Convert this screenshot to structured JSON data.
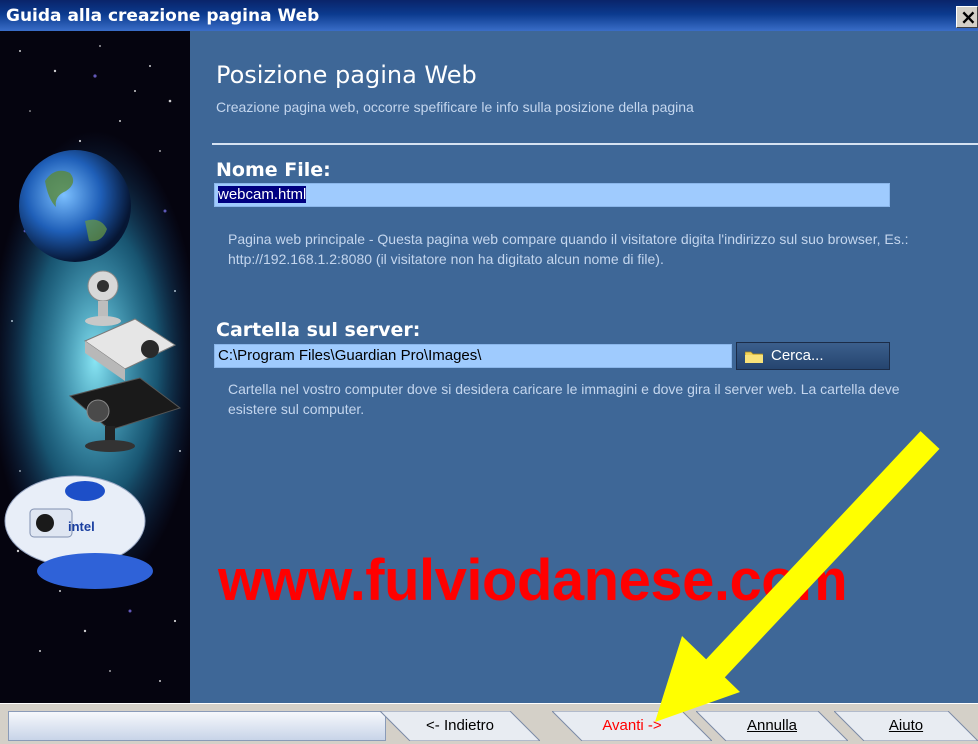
{
  "window": {
    "title": "Guida alla creazione pagina Web",
    "close_glyph": "×"
  },
  "header": {
    "title": "Posizione pagina Web",
    "subtitle": "Creazione pagina web, occorre spefificare le info sulla posizione della pagina"
  },
  "file_name": {
    "label": "Nome File:",
    "value": "webcam.html",
    "description": "Pagina web principale - Questa pagina web compare quando il visitatore digita l'indirizzo sul suo browser, Es.: http://192.168.1.2:8080 (il visitatore non ha digitato alcun nome di file)."
  },
  "server_folder": {
    "label": "Cartella sul server:",
    "value": "C:\\Program Files\\Guardian Pro\\Images\\",
    "browse_label": "Cerca...",
    "description": "Cartella nel vostro computer dove si desidera caricare le immagini e dove gira il server web. La cartella deve esistere sul computer."
  },
  "watermark": "www.fulviodanese.com",
  "buttons": {
    "back": "<- Indietro",
    "next": "Avanti ->",
    "cancel": "Annulla",
    "help": "Aiuto"
  },
  "art": {
    "logo_text": "intel"
  },
  "colors": {
    "panel": "#3e6797",
    "field": "#9fcbfe",
    "next_text": "#ff0000",
    "arrow": "#ffff00",
    "watermark": "#ff0000"
  }
}
